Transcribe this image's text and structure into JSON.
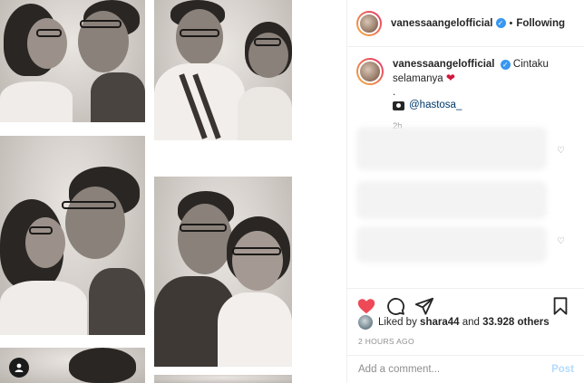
{
  "header": {
    "username": "vanessaangelofficial",
    "separator": "•",
    "follow_status": "Following"
  },
  "caption": {
    "username": "vanessaangelofficial",
    "text": "Cintaku selamanya",
    "emoji": "❤",
    "dot_line": ".",
    "credit_handle": "@hastosa_",
    "time_ago": "2h"
  },
  "actions": {
    "like_icon": "heart-filled-icon",
    "like_color": "#ed4956",
    "comment_icon": "comment-icon",
    "share_icon": "share-icon",
    "save_icon": "bookmark-icon"
  },
  "likes": {
    "prefix": "Liked by",
    "first_user": "shara44",
    "joiner": "and",
    "others": "33.928 others"
  },
  "post_date": "2 HOURS AGO",
  "comment_box": {
    "placeholder": "Add a comment...",
    "post_label": "Post"
  },
  "colors": {
    "verified_blue": "#3897f0",
    "link_blue": "#00376b",
    "muted": "#8e8e8e"
  }
}
